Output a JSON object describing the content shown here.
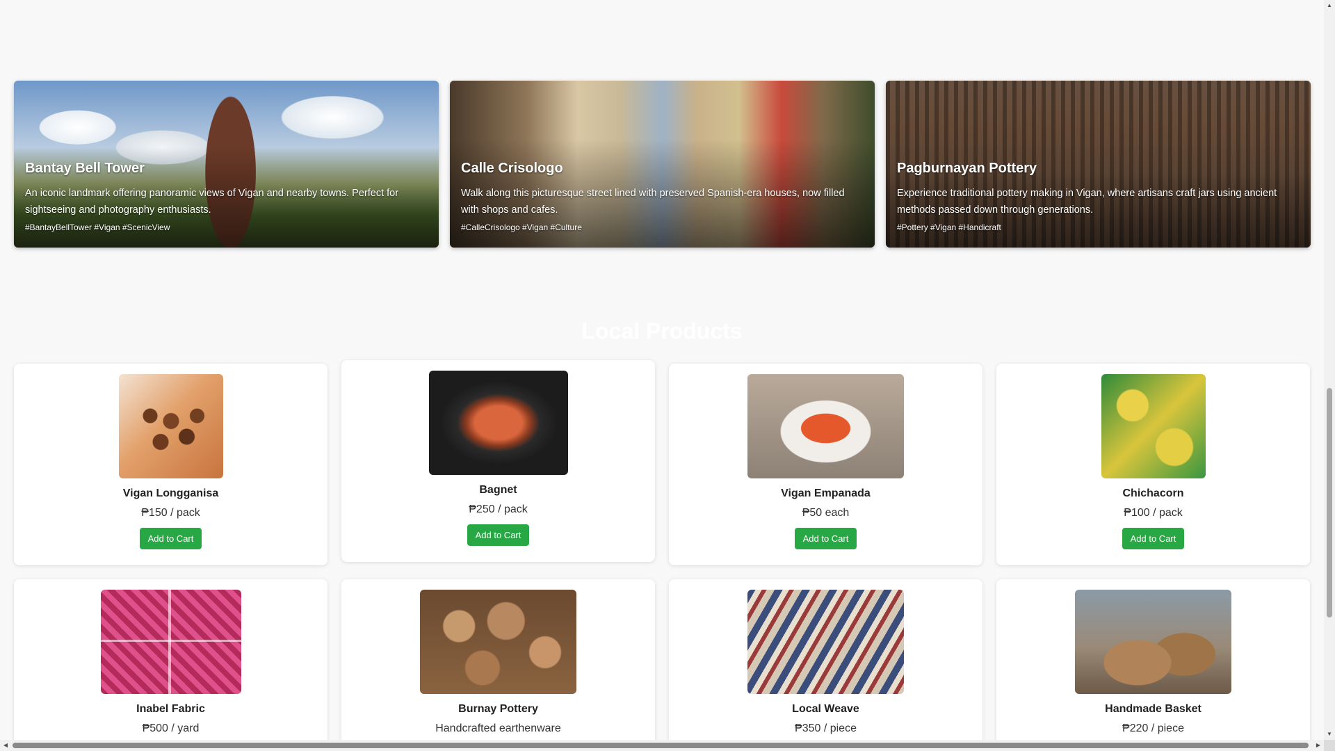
{
  "attractions": [
    {
      "title": "Bantay Bell Tower",
      "description": "An iconic landmark offering panoramic views of Vigan and nearby towns. Perfect for sightseeing and photography enthusiasts.",
      "tags": "#BantayBellTower #Vigan #ScenicView"
    },
    {
      "title": "Calle Crisologo",
      "description": "Walk along this picturesque street lined with preserved Spanish-era houses, now filled with shops and cafes.",
      "tags": "#CalleCrisologo #Vigan #Culture"
    },
    {
      "title": "Pagburnayan Pottery",
      "description": "Experience traditional pottery making in Vigan, where artisans craft jars using ancient methods passed down through generations.",
      "tags": "#Pottery #Vigan #Handicraft"
    }
  ],
  "products_section": {
    "title": "Local Products"
  },
  "products": [
    {
      "name": "Vigan Longganisa",
      "price": "₱150 / pack",
      "button": "Add to Cart"
    },
    {
      "name": "Bagnet",
      "price": "₱250 / pack",
      "button": "Add to Cart"
    },
    {
      "name": "Vigan Empanada",
      "price": "₱50 each",
      "button": "Add to Cart"
    },
    {
      "name": "Chichacorn",
      "price": "₱100 / pack",
      "button": "Add to Cart"
    },
    {
      "name": "Inabel Fabric",
      "price": "₱500 / yard"
    },
    {
      "name": "Burnay Pottery",
      "price": "Handcrafted earthenware"
    },
    {
      "name": "Local Weave",
      "price": "₱350 / piece"
    },
    {
      "name": "Handmade Basket",
      "price": "₱220 / piece"
    }
  ],
  "scrollbars": {
    "up_arrow": "▲",
    "down_arrow": "▼",
    "left_arrow": "◀",
    "right_arrow": "▶"
  },
  "colors": {
    "page_background": "#f8f8f8",
    "cart_button": "#28a745",
    "card_background": "#ffffff"
  },
  "icons": [
    "up-arrow-icon",
    "down-arrow-icon",
    "left-arrow-icon",
    "right-arrow-icon"
  ]
}
